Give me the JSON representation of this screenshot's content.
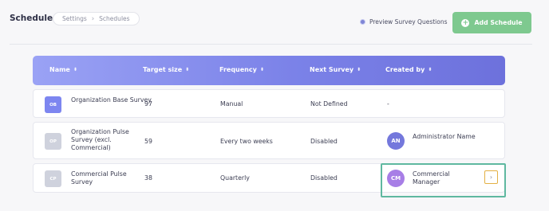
{
  "header": {
    "title": "Schedules",
    "breadcrumb": [
      "Settings",
      "Schedules"
    ],
    "breadcrumb_sep": "›",
    "preview_label": "Preview Survey Questions",
    "add_label": "Add Schedule",
    "add_icon": "plus-circle-icon"
  },
  "table": {
    "columns": [
      "Name",
      "Target size",
      "Frequency",
      "Next Survey",
      "Created by"
    ],
    "sort_glyph": "⬍",
    "rows": [
      {
        "badge": "OB",
        "badge_color": "#7d86f0",
        "name": "Organization Base Survey",
        "target": "97",
        "frequency": "Manual",
        "next": "Not Defined",
        "creator": "-",
        "avatar": "",
        "avatar_color": ""
      },
      {
        "badge": "OP",
        "badge_color": "#cfd2dd",
        "name": "Organization Pulse Survey (excl. Commercial)",
        "target": "59",
        "frequency": "Every two weeks",
        "next": "Disabled",
        "creator": "Administrator Name",
        "avatar": "AN",
        "avatar_color": "#7478dc"
      },
      {
        "badge": "CP",
        "badge_color": "#cfd2dd",
        "name": "Commercial Pulse Survey",
        "target": "38",
        "frequency": "Quarterly",
        "next": "Disabled",
        "creator": "Commercial Manager",
        "avatar": "CM",
        "avatar_color": "#a77ee6"
      }
    ],
    "row_action_icon": "chevron-right-icon",
    "row_action_glyph": "›"
  },
  "colors": {
    "accent": "#7b82e8",
    "success": "#7ec98f",
    "highlight": "#5fb8a0",
    "focus": "#e3b044"
  }
}
